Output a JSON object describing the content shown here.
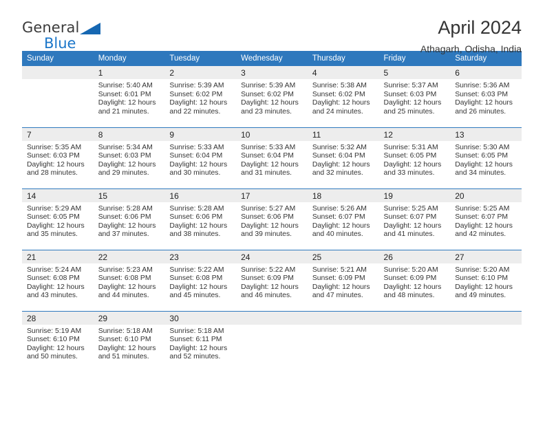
{
  "brand": {
    "name_part1": "General",
    "name_part2": "Blue",
    "triangle_color": "#1667b2",
    "blue_color": "#1b76c9"
  },
  "header": {
    "title": "April 2024",
    "subtitle": "Athagarh, Odisha, India"
  },
  "theme": {
    "header_bg": "#2e78bd",
    "daynum_bg": "#ededed",
    "separator": "#2e78bd",
    "text": "#333333"
  },
  "weekdays": [
    "Sunday",
    "Monday",
    "Tuesday",
    "Wednesday",
    "Thursday",
    "Friday",
    "Saturday"
  ],
  "weeks": [
    [
      {
        "day": "",
        "lines": []
      },
      {
        "day": "1",
        "lines": [
          "Sunrise: 5:40 AM",
          "Sunset: 6:01 PM",
          "Daylight: 12 hours",
          "and 21 minutes."
        ]
      },
      {
        "day": "2",
        "lines": [
          "Sunrise: 5:39 AM",
          "Sunset: 6:02 PM",
          "Daylight: 12 hours",
          "and 22 minutes."
        ]
      },
      {
        "day": "3",
        "lines": [
          "Sunrise: 5:39 AM",
          "Sunset: 6:02 PM",
          "Daylight: 12 hours",
          "and 23 minutes."
        ]
      },
      {
        "day": "4",
        "lines": [
          "Sunrise: 5:38 AM",
          "Sunset: 6:02 PM",
          "Daylight: 12 hours",
          "and 24 minutes."
        ]
      },
      {
        "day": "5",
        "lines": [
          "Sunrise: 5:37 AM",
          "Sunset: 6:03 PM",
          "Daylight: 12 hours",
          "and 25 minutes."
        ]
      },
      {
        "day": "6",
        "lines": [
          "Sunrise: 5:36 AM",
          "Sunset: 6:03 PM",
          "Daylight: 12 hours",
          "and 26 minutes."
        ]
      }
    ],
    [
      {
        "day": "7",
        "lines": [
          "Sunrise: 5:35 AM",
          "Sunset: 6:03 PM",
          "Daylight: 12 hours",
          "and 28 minutes."
        ]
      },
      {
        "day": "8",
        "lines": [
          "Sunrise: 5:34 AM",
          "Sunset: 6:03 PM",
          "Daylight: 12 hours",
          "and 29 minutes."
        ]
      },
      {
        "day": "9",
        "lines": [
          "Sunrise: 5:33 AM",
          "Sunset: 6:04 PM",
          "Daylight: 12 hours",
          "and 30 minutes."
        ]
      },
      {
        "day": "10",
        "lines": [
          "Sunrise: 5:33 AM",
          "Sunset: 6:04 PM",
          "Daylight: 12 hours",
          "and 31 minutes."
        ]
      },
      {
        "day": "11",
        "lines": [
          "Sunrise: 5:32 AM",
          "Sunset: 6:04 PM",
          "Daylight: 12 hours",
          "and 32 minutes."
        ]
      },
      {
        "day": "12",
        "lines": [
          "Sunrise: 5:31 AM",
          "Sunset: 6:05 PM",
          "Daylight: 12 hours",
          "and 33 minutes."
        ]
      },
      {
        "day": "13",
        "lines": [
          "Sunrise: 5:30 AM",
          "Sunset: 6:05 PM",
          "Daylight: 12 hours",
          "and 34 minutes."
        ]
      }
    ],
    [
      {
        "day": "14",
        "lines": [
          "Sunrise: 5:29 AM",
          "Sunset: 6:05 PM",
          "Daylight: 12 hours",
          "and 35 minutes."
        ]
      },
      {
        "day": "15",
        "lines": [
          "Sunrise: 5:28 AM",
          "Sunset: 6:06 PM",
          "Daylight: 12 hours",
          "and 37 minutes."
        ]
      },
      {
        "day": "16",
        "lines": [
          "Sunrise: 5:28 AM",
          "Sunset: 6:06 PM",
          "Daylight: 12 hours",
          "and 38 minutes."
        ]
      },
      {
        "day": "17",
        "lines": [
          "Sunrise: 5:27 AM",
          "Sunset: 6:06 PM",
          "Daylight: 12 hours",
          "and 39 minutes."
        ]
      },
      {
        "day": "18",
        "lines": [
          "Sunrise: 5:26 AM",
          "Sunset: 6:07 PM",
          "Daylight: 12 hours",
          "and 40 minutes."
        ]
      },
      {
        "day": "19",
        "lines": [
          "Sunrise: 5:25 AM",
          "Sunset: 6:07 PM",
          "Daylight: 12 hours",
          "and 41 minutes."
        ]
      },
      {
        "day": "20",
        "lines": [
          "Sunrise: 5:25 AM",
          "Sunset: 6:07 PM",
          "Daylight: 12 hours",
          "and 42 minutes."
        ]
      }
    ],
    [
      {
        "day": "21",
        "lines": [
          "Sunrise: 5:24 AM",
          "Sunset: 6:08 PM",
          "Daylight: 12 hours",
          "and 43 minutes."
        ]
      },
      {
        "day": "22",
        "lines": [
          "Sunrise: 5:23 AM",
          "Sunset: 6:08 PM",
          "Daylight: 12 hours",
          "and 44 minutes."
        ]
      },
      {
        "day": "23",
        "lines": [
          "Sunrise: 5:22 AM",
          "Sunset: 6:08 PM",
          "Daylight: 12 hours",
          "and 45 minutes."
        ]
      },
      {
        "day": "24",
        "lines": [
          "Sunrise: 5:22 AM",
          "Sunset: 6:09 PM",
          "Daylight: 12 hours",
          "and 46 minutes."
        ]
      },
      {
        "day": "25",
        "lines": [
          "Sunrise: 5:21 AM",
          "Sunset: 6:09 PM",
          "Daylight: 12 hours",
          "and 47 minutes."
        ]
      },
      {
        "day": "26",
        "lines": [
          "Sunrise: 5:20 AM",
          "Sunset: 6:09 PM",
          "Daylight: 12 hours",
          "and 48 minutes."
        ]
      },
      {
        "day": "27",
        "lines": [
          "Sunrise: 5:20 AM",
          "Sunset: 6:10 PM",
          "Daylight: 12 hours",
          "and 49 minutes."
        ]
      }
    ],
    [
      {
        "day": "28",
        "lines": [
          "Sunrise: 5:19 AM",
          "Sunset: 6:10 PM",
          "Daylight: 12 hours",
          "and 50 minutes."
        ]
      },
      {
        "day": "29",
        "lines": [
          "Sunrise: 5:18 AM",
          "Sunset: 6:10 PM",
          "Daylight: 12 hours",
          "and 51 minutes."
        ]
      },
      {
        "day": "30",
        "lines": [
          "Sunrise: 5:18 AM",
          "Sunset: 6:11 PM",
          "Daylight: 12 hours",
          "and 52 minutes."
        ]
      },
      {
        "day": "",
        "lines": []
      },
      {
        "day": "",
        "lines": []
      },
      {
        "day": "",
        "lines": []
      },
      {
        "day": "",
        "lines": []
      }
    ]
  ]
}
